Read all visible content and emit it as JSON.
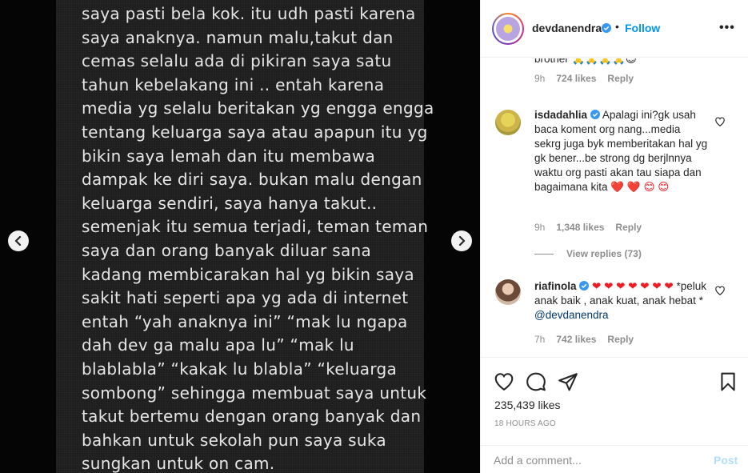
{
  "post": {
    "lines": [
      "saya pasti bela kok. itu udh pasti karena",
      "saya anaknya. namun malu,takut dan",
      "cemas selalu ada di pikiran saya satu",
      "tahun kebelakang ini .. entah karena",
      "media yg selalu beritakan yg engga engga",
      "tentang keluarga saya atau apapun itu yg",
      "bikin saya lemah dan itu membawa",
      "dampak ke diri saya. bukan malu dengan",
      "keluarga sendiri, saya hanya takut..",
      "semenjak itu semua terjadi, teman teman",
      "saya dan orang banyak diluar sana",
      "kadang membicarakan hal yg bikin saya",
      "sakit hati seperti apa yg ada di internet",
      "entah “yah anaknya ini” “mak lu ngapa",
      "dah dev ga malu apa lu” “mak lu",
      "blablabla” “kakak lu blabla” “keluarga",
      "sombong” sehingga membuat saya untuk",
      "takut bertemu dengan orang banyak dan",
      "bahkan untuk sekolah pun saya suka",
      "sungkan untuk on cam."
    ]
  },
  "header": {
    "username": "devdanendra",
    "dot": "•",
    "follow_label": "Follow",
    "more_label": "•••"
  },
  "comments": [
    {
      "text": "brother 🙏🙏🙏🙏😊",
      "time": "9h",
      "likes": "724 likes",
      "reply": "Reply"
    },
    {
      "username": "isdadahlia",
      "text": "Apalagi ini?gk usah baca koment org nang...media sekrg juga byk memberitakan hal yg gk bener...be strong dg berjlnnya waktu org pasti akan tau siapa dan bagaimana kita",
      "emoji": "❤️ ❤️ 😊 😊",
      "time": "9h",
      "likes": "1,348 likes",
      "reply": "Reply",
      "view_replies": "View replies (73)"
    },
    {
      "username": "riafinola",
      "hearts": "❤ ❤ ❤ ❤ ❤ ❤ ❤",
      "text": "*peluk anak baik , anak kuat, anak hebat *",
      "mention": "@devdanendra",
      "time": "7h",
      "likes": "742 likes",
      "reply": "Reply"
    }
  ],
  "actions": {
    "likes": "235,439 likes",
    "time": "18 HOURS AGO"
  },
  "add_comment": {
    "placeholder": "Add a comment...",
    "post_label": "Post"
  },
  "colors": {
    "accent": "#0095f6",
    "post_disabled": "#b2dffc",
    "heart": "#ed1c24"
  }
}
